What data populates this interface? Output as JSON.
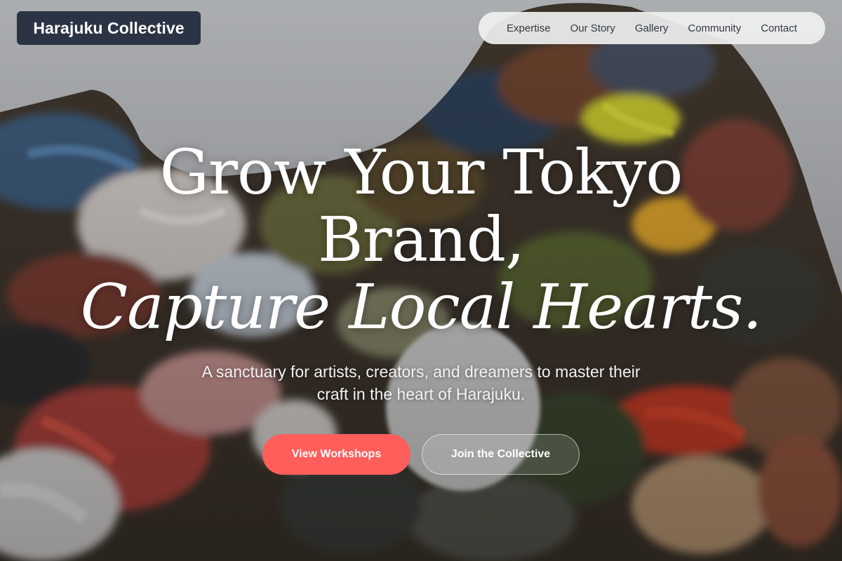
{
  "brand": {
    "logo_text": "Harajuku Collective"
  },
  "nav": {
    "items": [
      {
        "label": "Expertise"
      },
      {
        "label": "Our Story"
      },
      {
        "label": "Gallery"
      },
      {
        "label": "Community"
      },
      {
        "label": "Contact"
      }
    ]
  },
  "hero": {
    "title_line1": "Grow Your Tokyo",
    "title_line2": "Brand,",
    "title_line3": "Capture Local Hearts.",
    "subtitle": "A sanctuary for artists, creators, and dreamers to master their craft in the heart of Harajuku.",
    "primary_button": "View Workshops",
    "secondary_button": "Join the Collective"
  },
  "colors": {
    "accent": "#ff5e5b",
    "logo_bg": "#2a3444",
    "nav_bg": "#f0f0f0",
    "nav_text": "#333a44"
  },
  "background": {
    "icon": "paint-palette-photo"
  }
}
